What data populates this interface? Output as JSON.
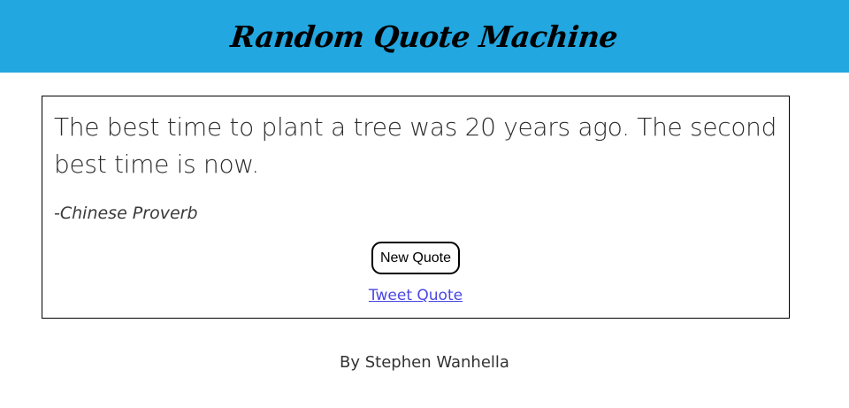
{
  "header": {
    "title": "Random Quote Machine",
    "background_color": "#22a7e0"
  },
  "quote": {
    "text": "The best time to plant a tree was 20 years ago. The second best time is now.",
    "author": "-Chinese Proverb"
  },
  "actions": {
    "new_quote_label": "New Quote",
    "tweet_label": "Tweet Quote",
    "link_color": "#4a47e6"
  },
  "footer": {
    "credit": "By Stephen Wanhella"
  }
}
